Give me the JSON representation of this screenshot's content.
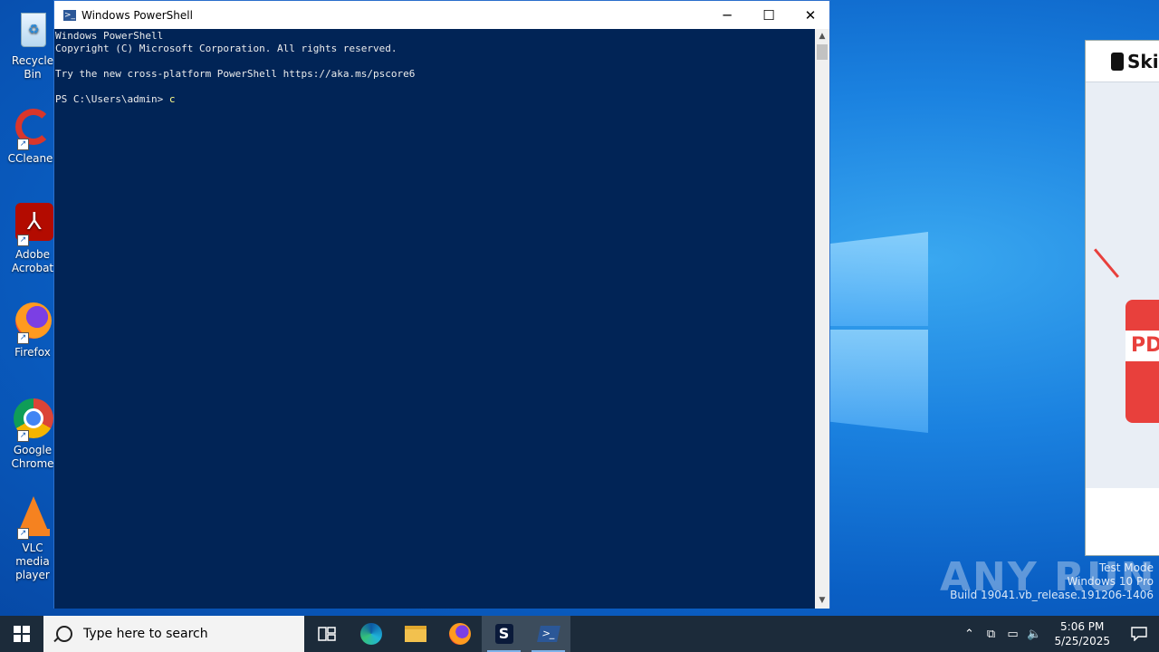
{
  "desktop": {
    "icons": [
      {
        "label": "Recycle Bin"
      },
      {
        "label": "CCleaner"
      },
      {
        "label": "Adobe Acrobat"
      },
      {
        "label": "Firefox"
      },
      {
        "label": "Google Chrome"
      },
      {
        "label": "VLC media player"
      }
    ]
  },
  "powershell": {
    "title": "Windows PowerShell",
    "lines": [
      "Windows PowerShell",
      "Copyright (C) Microsoft Corporation. All rights reserved.",
      "",
      "Try the new cross-platform PowerShell https://aka.ms/pscore6",
      ""
    ],
    "prompt": "PS C:\\Users\\admin> ",
    "input": "c",
    "min_glyph": "─",
    "max_glyph": "☐",
    "close_glyph": "✕"
  },
  "right_app": {
    "header": "Ski",
    "badge": "PD"
  },
  "watermark": {
    "brand": "ANY RUN",
    "mode": "Test Mode",
    "edition": "Windows 10 Pro",
    "build": "Build 19041.vb_release.191206-1406"
  },
  "taskbar": {
    "search_placeholder": "Type here to search",
    "time": "5:06 PM",
    "date": "5/25/2025"
  },
  "colors": {
    "console_bg": "#012456",
    "taskbar_bg": "#1c2b3a",
    "accent": "#0078d7"
  }
}
